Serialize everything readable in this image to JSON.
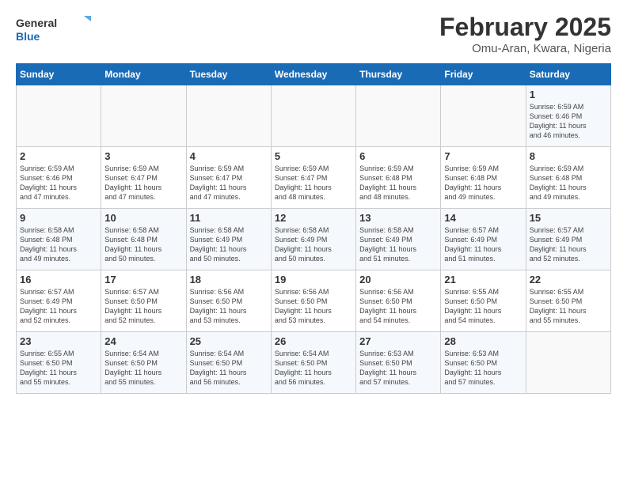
{
  "header": {
    "logo_line1": "General",
    "logo_line2": "Blue",
    "month_title": "February 2025",
    "location": "Omu-Aran, Kwara, Nigeria"
  },
  "days_of_week": [
    "Sunday",
    "Monday",
    "Tuesday",
    "Wednesday",
    "Thursday",
    "Friday",
    "Saturday"
  ],
  "weeks": [
    [
      {
        "day": "",
        "info": ""
      },
      {
        "day": "",
        "info": ""
      },
      {
        "day": "",
        "info": ""
      },
      {
        "day": "",
        "info": ""
      },
      {
        "day": "",
        "info": ""
      },
      {
        "day": "",
        "info": ""
      },
      {
        "day": "1",
        "info": "Sunrise: 6:59 AM\nSunset: 6:46 PM\nDaylight: 11 hours\nand 46 minutes."
      }
    ],
    [
      {
        "day": "2",
        "info": "Sunrise: 6:59 AM\nSunset: 6:46 PM\nDaylight: 11 hours\nand 47 minutes."
      },
      {
        "day": "3",
        "info": "Sunrise: 6:59 AM\nSunset: 6:47 PM\nDaylight: 11 hours\nand 47 minutes."
      },
      {
        "day": "4",
        "info": "Sunrise: 6:59 AM\nSunset: 6:47 PM\nDaylight: 11 hours\nand 47 minutes."
      },
      {
        "day": "5",
        "info": "Sunrise: 6:59 AM\nSunset: 6:47 PM\nDaylight: 11 hours\nand 48 minutes."
      },
      {
        "day": "6",
        "info": "Sunrise: 6:59 AM\nSunset: 6:48 PM\nDaylight: 11 hours\nand 48 minutes."
      },
      {
        "day": "7",
        "info": "Sunrise: 6:59 AM\nSunset: 6:48 PM\nDaylight: 11 hours\nand 49 minutes."
      },
      {
        "day": "8",
        "info": "Sunrise: 6:59 AM\nSunset: 6:48 PM\nDaylight: 11 hours\nand 49 minutes."
      }
    ],
    [
      {
        "day": "9",
        "info": "Sunrise: 6:58 AM\nSunset: 6:48 PM\nDaylight: 11 hours\nand 49 minutes."
      },
      {
        "day": "10",
        "info": "Sunrise: 6:58 AM\nSunset: 6:48 PM\nDaylight: 11 hours\nand 50 minutes."
      },
      {
        "day": "11",
        "info": "Sunrise: 6:58 AM\nSunset: 6:49 PM\nDaylight: 11 hours\nand 50 minutes."
      },
      {
        "day": "12",
        "info": "Sunrise: 6:58 AM\nSunset: 6:49 PM\nDaylight: 11 hours\nand 50 minutes."
      },
      {
        "day": "13",
        "info": "Sunrise: 6:58 AM\nSunset: 6:49 PM\nDaylight: 11 hours\nand 51 minutes."
      },
      {
        "day": "14",
        "info": "Sunrise: 6:57 AM\nSunset: 6:49 PM\nDaylight: 11 hours\nand 51 minutes."
      },
      {
        "day": "15",
        "info": "Sunrise: 6:57 AM\nSunset: 6:49 PM\nDaylight: 11 hours\nand 52 minutes."
      }
    ],
    [
      {
        "day": "16",
        "info": "Sunrise: 6:57 AM\nSunset: 6:49 PM\nDaylight: 11 hours\nand 52 minutes."
      },
      {
        "day": "17",
        "info": "Sunrise: 6:57 AM\nSunset: 6:50 PM\nDaylight: 11 hours\nand 52 minutes."
      },
      {
        "day": "18",
        "info": "Sunrise: 6:56 AM\nSunset: 6:50 PM\nDaylight: 11 hours\nand 53 minutes."
      },
      {
        "day": "19",
        "info": "Sunrise: 6:56 AM\nSunset: 6:50 PM\nDaylight: 11 hours\nand 53 minutes."
      },
      {
        "day": "20",
        "info": "Sunrise: 6:56 AM\nSunset: 6:50 PM\nDaylight: 11 hours\nand 54 minutes."
      },
      {
        "day": "21",
        "info": "Sunrise: 6:55 AM\nSunset: 6:50 PM\nDaylight: 11 hours\nand 54 minutes."
      },
      {
        "day": "22",
        "info": "Sunrise: 6:55 AM\nSunset: 6:50 PM\nDaylight: 11 hours\nand 55 minutes."
      }
    ],
    [
      {
        "day": "23",
        "info": "Sunrise: 6:55 AM\nSunset: 6:50 PM\nDaylight: 11 hours\nand 55 minutes."
      },
      {
        "day": "24",
        "info": "Sunrise: 6:54 AM\nSunset: 6:50 PM\nDaylight: 11 hours\nand 55 minutes."
      },
      {
        "day": "25",
        "info": "Sunrise: 6:54 AM\nSunset: 6:50 PM\nDaylight: 11 hours\nand 56 minutes."
      },
      {
        "day": "26",
        "info": "Sunrise: 6:54 AM\nSunset: 6:50 PM\nDaylight: 11 hours\nand 56 minutes."
      },
      {
        "day": "27",
        "info": "Sunrise: 6:53 AM\nSunset: 6:50 PM\nDaylight: 11 hours\nand 57 minutes."
      },
      {
        "day": "28",
        "info": "Sunrise: 6:53 AM\nSunset: 6:50 PM\nDaylight: 11 hours\nand 57 minutes."
      },
      {
        "day": "",
        "info": ""
      }
    ]
  ]
}
